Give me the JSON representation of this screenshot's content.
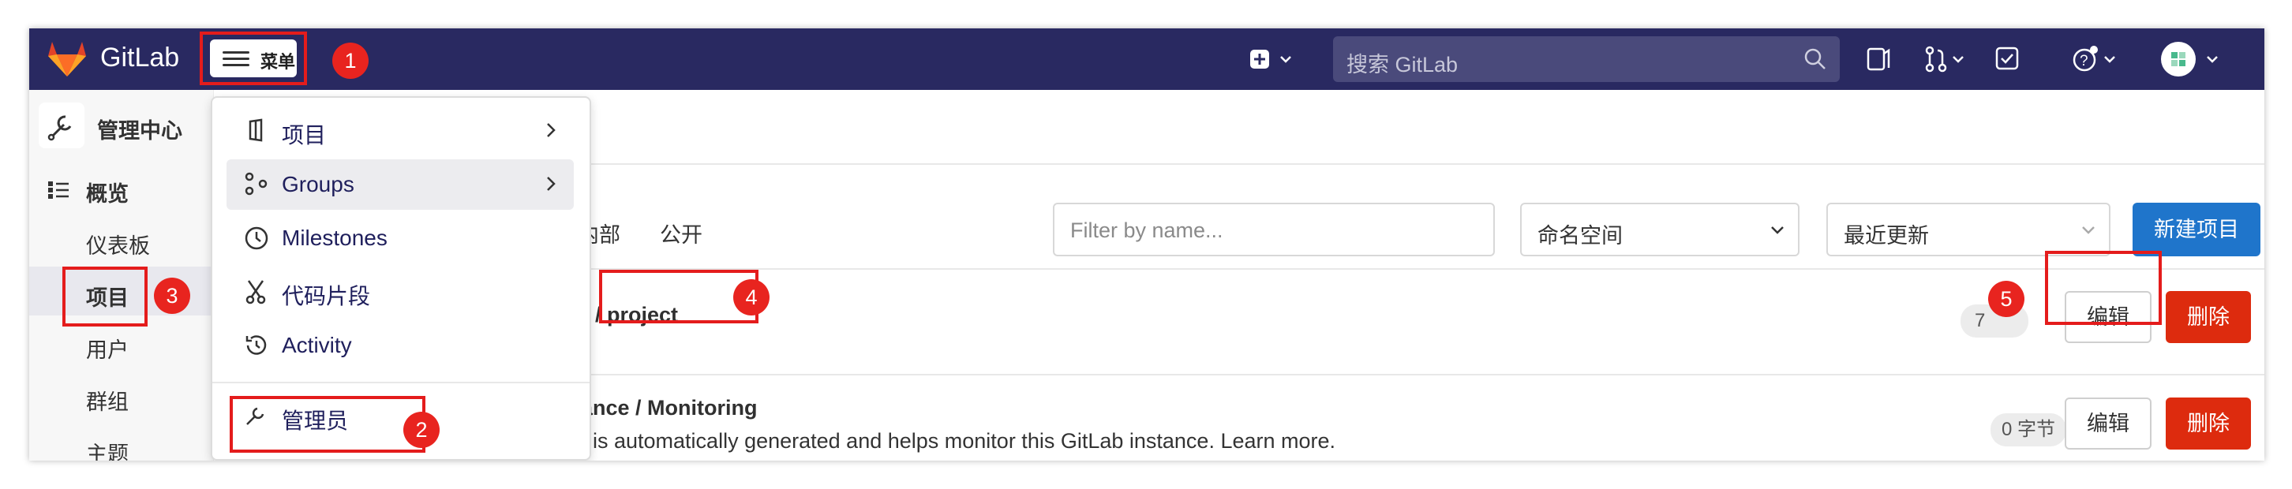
{
  "header": {
    "brand": "GitLab",
    "menu_label": "菜单",
    "search_placeholder": "搜索 GitLab"
  },
  "sidebar": {
    "title": "管理中心",
    "section": "概览",
    "items": [
      "仪表板",
      "项目",
      "用户",
      "群组",
      "主题"
    ]
  },
  "main": {
    "tabs": [
      "内部",
      "公开"
    ],
    "filter_placeholder": "Filter by name...",
    "namespace_select": "命名空间",
    "sort_select": "最近更新",
    "new_project_button": "新建项目",
    "projects": [
      {
        "name": "r / project",
        "size": "7",
        "edit": "编辑",
        "delete": "删除"
      },
      {
        "name": "ance / Monitoring",
        "description": "t is automatically generated and helps monitor this GitLab instance. Learn more.",
        "size": "0 字节",
        "edit": "编辑",
        "delete": "删除"
      }
    ]
  },
  "menu_dropdown": {
    "items": [
      "项目",
      "Groups",
      "Milestones",
      "代码片段",
      "Activity",
      "管理员"
    ]
  },
  "annotations": [
    "1",
    "2",
    "3",
    "4",
    "5"
  ],
  "colors": {
    "topbar": "#292961",
    "annotation_red": "#e41c1c",
    "primary_blue": "#1f75cb",
    "danger_red": "#dd2b0e"
  }
}
